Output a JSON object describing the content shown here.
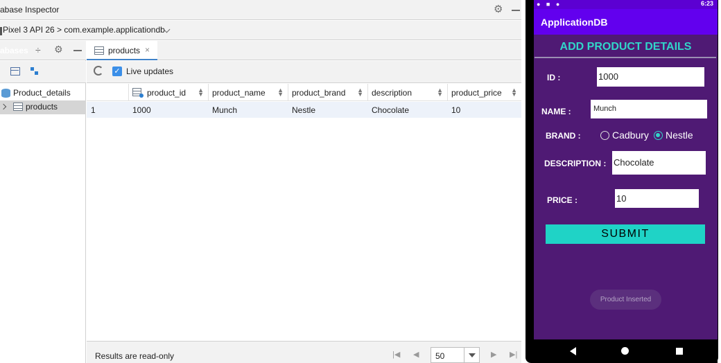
{
  "ide": {
    "window_title": "abase Inspector",
    "device_path": "Pixel 3 API 26 > com.example.applicationdb",
    "left_panel": {
      "title": "abases",
      "database": "Product_details",
      "table": "products"
    },
    "tab": {
      "label": "products",
      "close": "×"
    },
    "live_updates_label": "Live updates",
    "live_updates_checked": true,
    "columns": [
      "product_id",
      "product_name",
      "product_brand",
      "description",
      "product_price"
    ],
    "rows": [
      {
        "index": "1",
        "cells": [
          "1000",
          "Munch",
          "Nestle",
          "Chocolate",
          "10"
        ]
      }
    ],
    "footer": {
      "status": "Results are read-only",
      "page_size": "50"
    },
    "colors": {
      "accent": "#4083c9",
      "selected_row": "#edf2fa"
    }
  },
  "emulator": {
    "status_time": "6:23",
    "app_title": "ApplicationDB",
    "heading": "ADD PRODUCT DETAILS",
    "labels": {
      "id": "ID :",
      "name": "NAME :",
      "brand": "BRAND :",
      "description": "DESCRIPTION :",
      "price": "PRICE :"
    },
    "values": {
      "id": "1000",
      "name": "Munch",
      "description": "Chocolate",
      "price": "10"
    },
    "brand_options": [
      "Cadbury",
      "Nestle"
    ],
    "brand_selected": "Nestle",
    "submit_label": "SUBMIT",
    "toast": "Product Inserted",
    "colors": {
      "primary": "#6200ee",
      "status_bar": "#5c00d2",
      "background": "#4f1a74",
      "accent": "#1fd3c6"
    }
  }
}
